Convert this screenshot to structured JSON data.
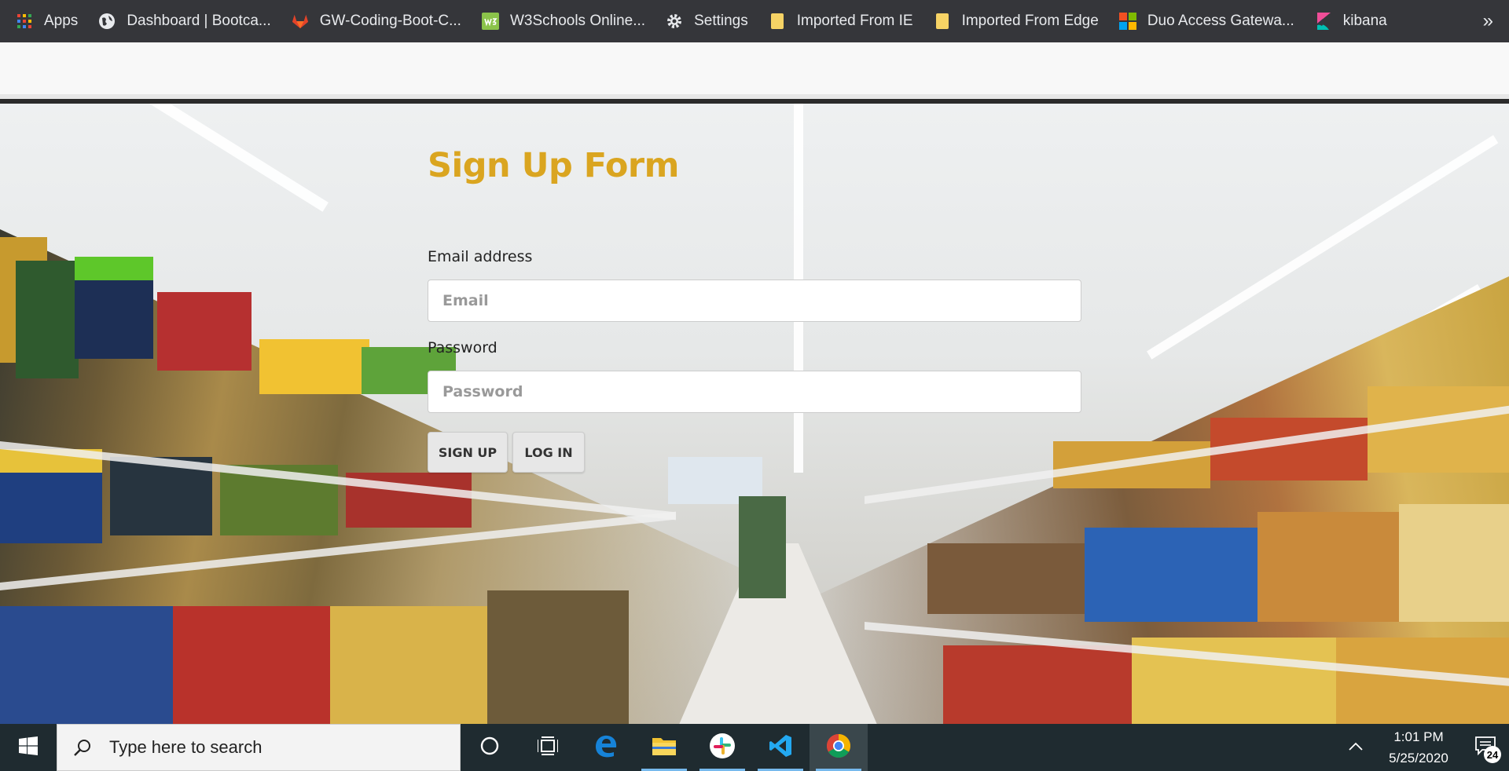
{
  "bookmarks": {
    "items": [
      {
        "label": "Apps",
        "icon": "apps-grid-icon"
      },
      {
        "label": "Dashboard | Bootca...",
        "icon": "globe-icon"
      },
      {
        "label": "GW-Coding-Boot-C...",
        "icon": "gitlab-icon"
      },
      {
        "label": "W3Schools Online...",
        "icon": "w3schools-icon"
      },
      {
        "label": "Settings",
        "icon": "gear-icon"
      },
      {
        "label": "Imported From IE",
        "icon": "folder-icon"
      },
      {
        "label": "Imported From Edge",
        "icon": "folder-icon"
      },
      {
        "label": "Duo Access Gatewa...",
        "icon": "microsoft-icon"
      },
      {
        "label": "kibana",
        "icon": "kibana-icon"
      }
    ],
    "more": "»"
  },
  "form": {
    "title": "Sign Up Form",
    "email_label": "Email address",
    "email_placeholder": "Email",
    "email_value": "",
    "password_label": "Password",
    "password_placeholder": "Password",
    "password_value": "",
    "signup_label": "SIGN UP",
    "login_label": "LOG IN"
  },
  "taskbar": {
    "search_placeholder": "Type here to search",
    "time": "1:01 PM",
    "date": "5/25/2020",
    "notification_count": "24"
  },
  "colors": {
    "title_accent": "#daa520",
    "bookmark_bar": "#35363a",
    "taskbar": "#1f2b30"
  }
}
